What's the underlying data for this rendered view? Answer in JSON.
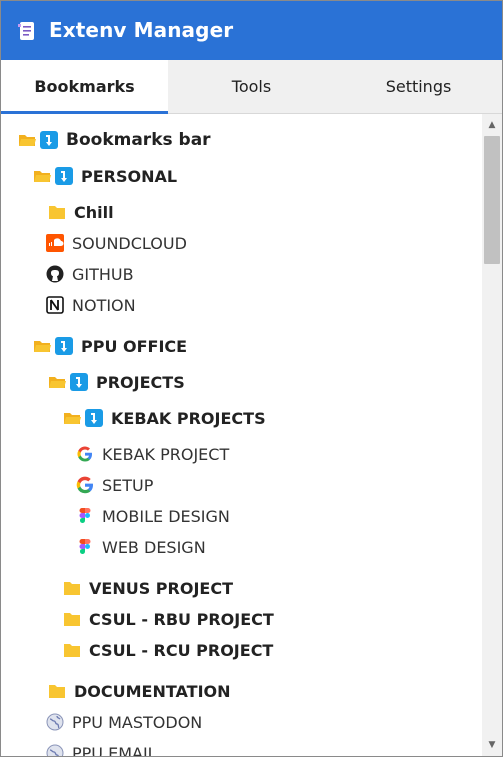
{
  "app": {
    "title": "Extenv Manager"
  },
  "tabs": [
    {
      "label": "Bookmarks",
      "active": true
    },
    {
      "label": "Tools",
      "active": false
    },
    {
      "label": "Settings",
      "active": false
    }
  ],
  "tree": {
    "bookmarks_bar": "Bookmarks bar",
    "personal": "PERSONAL",
    "chill": "Chill",
    "soundcloud": "SOUNDCLOUD",
    "github": "GITHUB",
    "notion": "NOTION",
    "ppu_office": "PPU OFFICE",
    "projects": "PROJECTS",
    "kebak_projects": "KEBAK PROJECTS",
    "kebak_project": "KEBAK PROJECT",
    "setup": "SETUP",
    "mobile_design": "MOBILE DESIGN",
    "web_design": "WEB DESIGN",
    "venus_project": "VENUS PROJECT",
    "csul_rbu": "CSUL - RBU PROJECT",
    "csul_rcu": "CSUL - RCU PROJECT",
    "documentation": "DOCUMENTATION",
    "ppu_mastodon": "PPU MASTODON",
    "ppu_email": "PPU EMAIL"
  },
  "icons": {
    "folder_color": "#f8c531",
    "open_folder_badge": "#1a9be6",
    "soundcloud": "#ff5500",
    "accent": "#2a72d6"
  }
}
